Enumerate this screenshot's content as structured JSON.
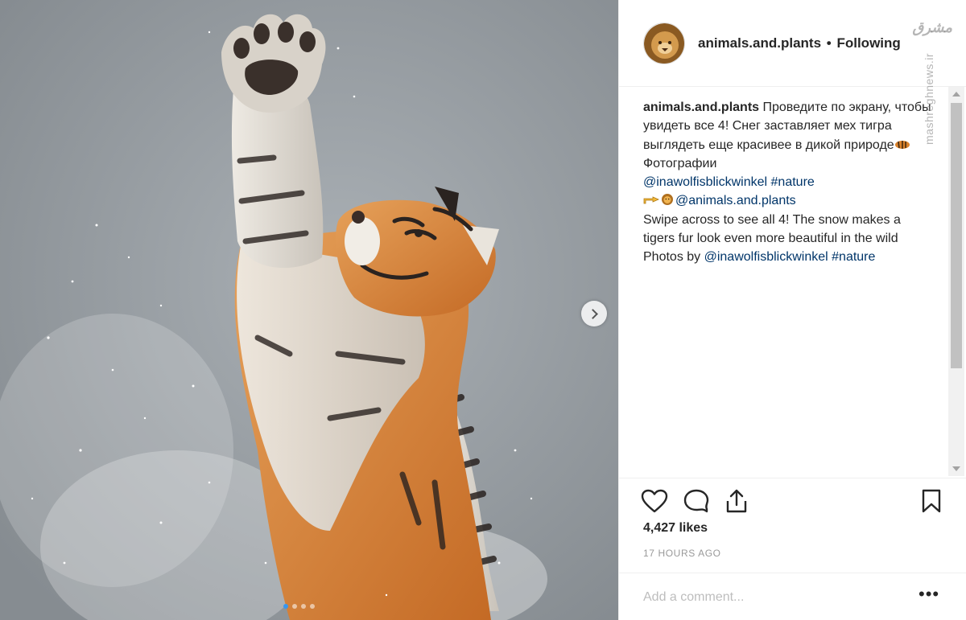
{
  "post": {
    "image_alt": "Tiger reaching up in the snow",
    "carousel_dots": 4,
    "carousel_active_index": 0
  },
  "header": {
    "username": "animals.and.plants",
    "separator": "•",
    "follow_status": "Following",
    "watermark": "مشرق",
    "watermark_side": "mashreghnews.ir"
  },
  "caption": {
    "username": "animals.and.plants",
    "line_ru_1": "Проведите по экрану, чтобы увидеть все 4! Снег заставляет мех тигра выглядеть еще красивее в дикой природе",
    "line_ru_2": " Фотографии",
    "mention_1": "@inawolfisblickwinkel",
    "hashtag_1": "#nature",
    "mention_2": "@animals.and.plants",
    "line_en": "Swipe across to see all 4! The snow makes a tigers fur look even more beautiful in the wild",
    "photos_by": "Photos by ",
    "mention_3": "@inawolfisblickwinkel",
    "hashtag_2": "#nature"
  },
  "actions": {
    "icons": [
      "heart-icon",
      "comment-icon",
      "share-icon",
      "bookmark-icon"
    ]
  },
  "stats": {
    "likes": "4,427 likes",
    "time": "17 HOURS AGO"
  },
  "comment": {
    "placeholder": "Add a comment...",
    "more_label": "•••"
  },
  "colors": {
    "link": "#003569",
    "text": "#262626",
    "muted": "#999999",
    "border": "#efefef",
    "active_dot": "#3897f0"
  }
}
